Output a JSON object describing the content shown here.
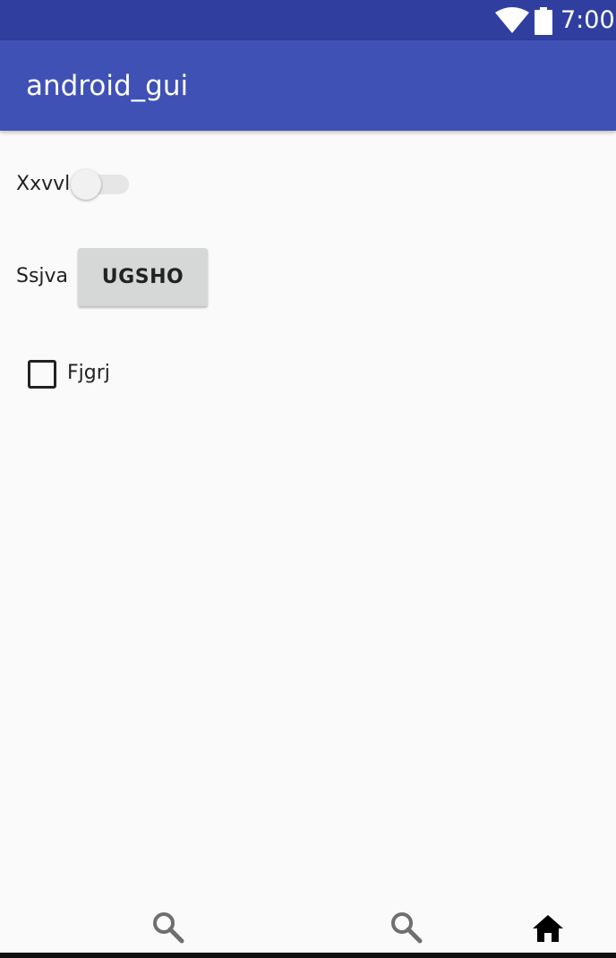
{
  "status_bar": {
    "time": "7:00",
    "icons": [
      "wifi-icon",
      "battery-icon"
    ]
  },
  "app_bar": {
    "title": "android_gui"
  },
  "content": {
    "switch_row": {
      "label": "Xxvvl",
      "checked": false
    },
    "button_row": {
      "label": "Ssjva",
      "button_label": "UGSHO"
    },
    "checkbox_row": {
      "label": "Fjgrj",
      "checked": false
    }
  },
  "bottom_nav": {
    "items": [
      {
        "icon": "search-icon",
        "selected": false
      },
      {
        "icon": "search-icon",
        "selected": false
      },
      {
        "icon": "home-icon",
        "selected": true
      }
    ]
  },
  "colors": {
    "status_bar": "#303f9f",
    "app_bar": "#3f51b5",
    "background": "#fafafa",
    "button": "#d6d7d7",
    "nav_inactive": "#6f6f6f",
    "nav_active": "#000000"
  }
}
